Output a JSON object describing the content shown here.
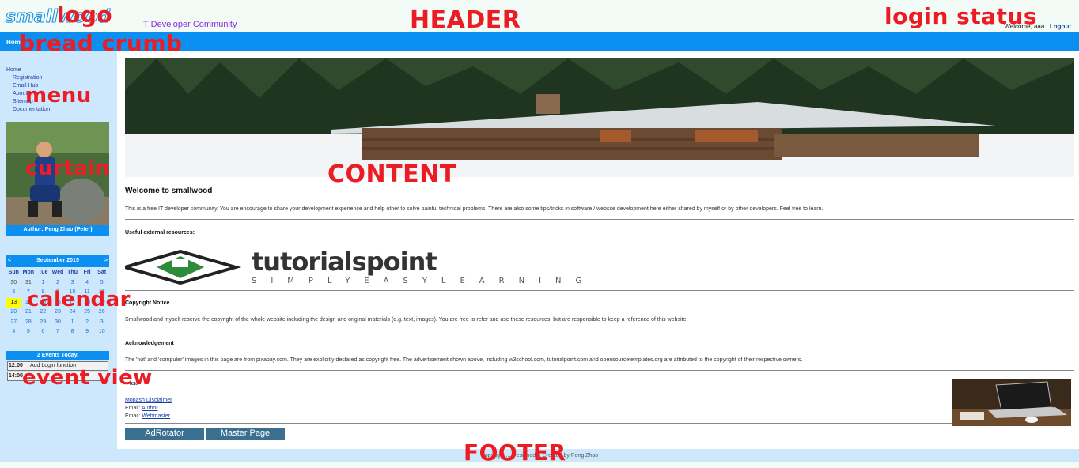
{
  "header": {
    "logo_text": "smallwood",
    "tagline": "IT Developer Community",
    "welcome": "Welcome, aaa",
    "separator": "|",
    "logout": "Logout"
  },
  "breadcrumb": {
    "home": "Home"
  },
  "menu": {
    "home": "Home",
    "items": [
      "Registration",
      "Email Hub",
      "About",
      "Sitemap",
      "Documentation"
    ]
  },
  "author": "Author: Peng Zhao (Peter)",
  "calendar": {
    "prev": "<",
    "next": ">",
    "month": "September 2015",
    "dow": [
      "Sun",
      "Mon",
      "Tue",
      "Wed",
      "Thu",
      "Fri",
      "Sat"
    ],
    "weeks": [
      [
        "30",
        "31",
        "1",
        "2",
        "3",
        "4",
        "5"
      ],
      [
        "6",
        "7",
        "8",
        "9",
        "10",
        "11",
        "12"
      ],
      [
        "13",
        "14",
        "15",
        "16",
        "17",
        "18",
        "19"
      ],
      [
        "20",
        "21",
        "22",
        "23",
        "24",
        "25",
        "26"
      ],
      [
        "27",
        "28",
        "29",
        "30",
        "1",
        "2",
        "3"
      ],
      [
        "4",
        "5",
        "6",
        "7",
        "8",
        "9",
        "10"
      ]
    ],
    "today": "13"
  },
  "events": {
    "title": "2 Events Today.",
    "rows": [
      {
        "time": "12:00",
        "text": "Add Login function"
      },
      {
        "time": "14:00",
        "text": ""
      }
    ]
  },
  "content": {
    "welcome_title": "Welcome to smallwood",
    "intro": "This is a free IT developer community. You are encourage to share your development experience and help other to solve painful technical problems. There are also some tips/tricks in software / website development here either shared by myself or by other developers. Feel free to learn.",
    "resources_head": "Useful external resources:",
    "tp_logo": "tutorialspoint",
    "tp_tagline": "SIMPLYEASYLEARNING",
    "copyright_head": "Copyright Notice",
    "copyright_text": "Smallwood and myself reserve the copyright of the whole website including the design and original materials (e.g. text, images). You are free to refer and use these resources, but are responsible to keep a reference of this website.",
    "ack_head": "Acknowledgement",
    "ack_text": "The 'hut' and 'computer' images in this page are from pixabay.com. They are explicitly declared as copyright free. The advertisement shown above, including w3school.com, tutorialpoint.com and opensourcetemplates.org are attributed to the copyright of their respective owners.",
    "links_head": "ks:",
    "disclaimer": "Monash Disclaimer",
    "email_label": "Email:",
    "author_link": "Author",
    "webmaster_link": "Webmaster",
    "btn_adrotator": "AdRotator",
    "btn_master": "Master Page"
  },
  "footer": {
    "text": "Copyright ... Designed & Created by Peng Zhao"
  },
  "annotations": {
    "logo": "logo",
    "breadcrumb": "bread crumb",
    "header": "HEADER",
    "login_status": "login status",
    "menu": "menu",
    "curtain": "curtain",
    "content": "CONTENT",
    "calendar": "calendar",
    "event_view": "event view",
    "footer": "FOOTER"
  },
  "colors": {
    "brand_blue": "#0b8ff0",
    "side_bg": "#cde7fc",
    "annotation_red": "#ec1c24",
    "today_highlight": "#ffff00",
    "button": "#3b6f8f"
  }
}
